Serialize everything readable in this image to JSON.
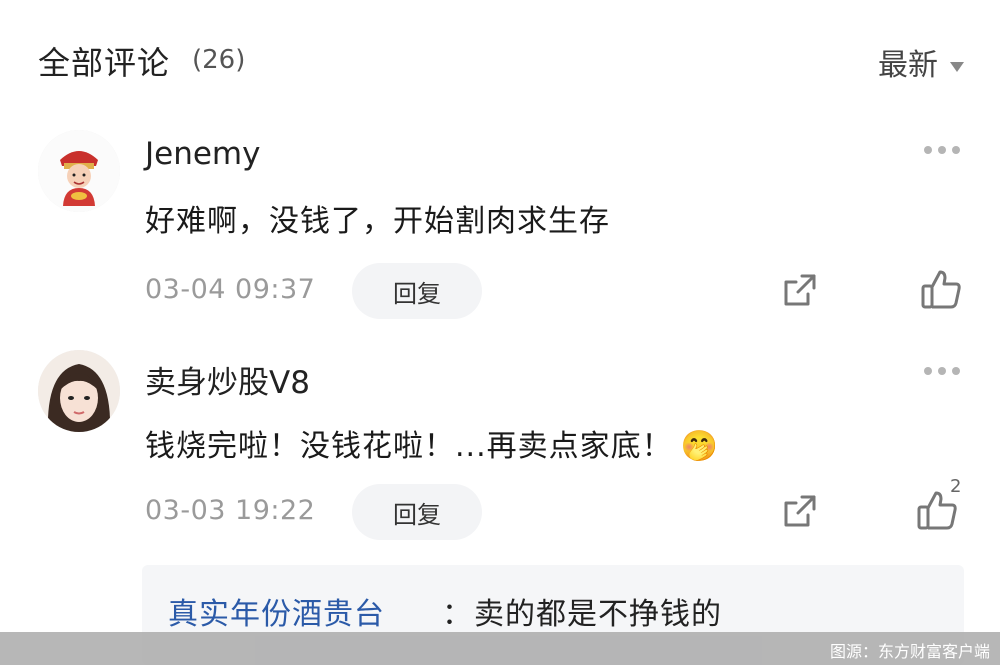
{
  "header": {
    "title": "全部评论",
    "count": "(26)",
    "sort_label": "最新"
  },
  "comments": [
    {
      "username": "Jenemy",
      "content": "好难啊，没钱了，开始割肉求生存",
      "time": "03-04 09:37",
      "reply_label": "回复",
      "likes": ""
    },
    {
      "username": "卖身炒股V8",
      "content": "钱烧完啦！没钱花啦！...再卖点家底！",
      "emoji": "🤭",
      "time": "03-03 19:22",
      "reply_label": "回复",
      "likes": "2"
    }
  ],
  "sub_reply": {
    "username": "真实年份酒贵台",
    "separator": "：",
    "text": "卖的都是不挣钱的"
  },
  "watermark": "图源：东方财富客户端",
  "colors": {
    "link_blue": "#2b5aa8",
    "muted": "#9a9a9a",
    "subreply_bg": "#f5f6f8"
  }
}
